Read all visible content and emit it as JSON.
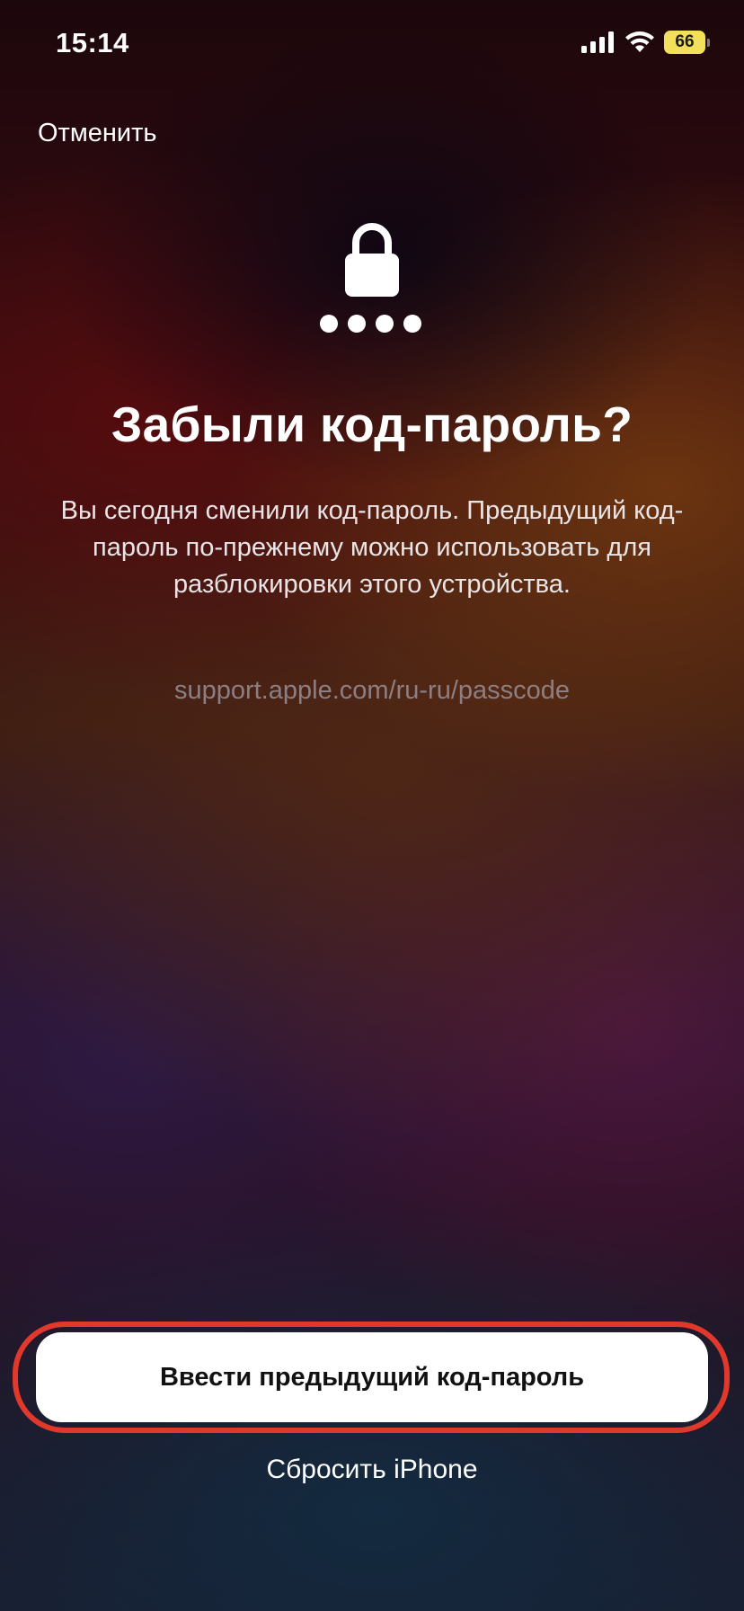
{
  "status_bar": {
    "time": "15:14",
    "battery_level": "66",
    "icons": [
      "cellular-signal-icon",
      "wifi-icon",
      "battery-icon"
    ],
    "battery_color": "#f2df5a"
  },
  "header": {
    "cancel_label": "Отменить"
  },
  "main": {
    "icons": [
      "lock-icon",
      "passcode-dots-icon"
    ],
    "title": "Забыли код-пароль?",
    "description": "Вы сегодня сменили код-пароль. Предыдущий код-пароль по-прежнему можно использовать для разблокировки этого устройства.",
    "support_link": "support.apple.com/ru-ru/passcode"
  },
  "actions": {
    "primary_label": "Ввести предыдущий код-пароль",
    "secondary_label": "Сбросить iPhone",
    "highlight_color": "#e0392b"
  }
}
